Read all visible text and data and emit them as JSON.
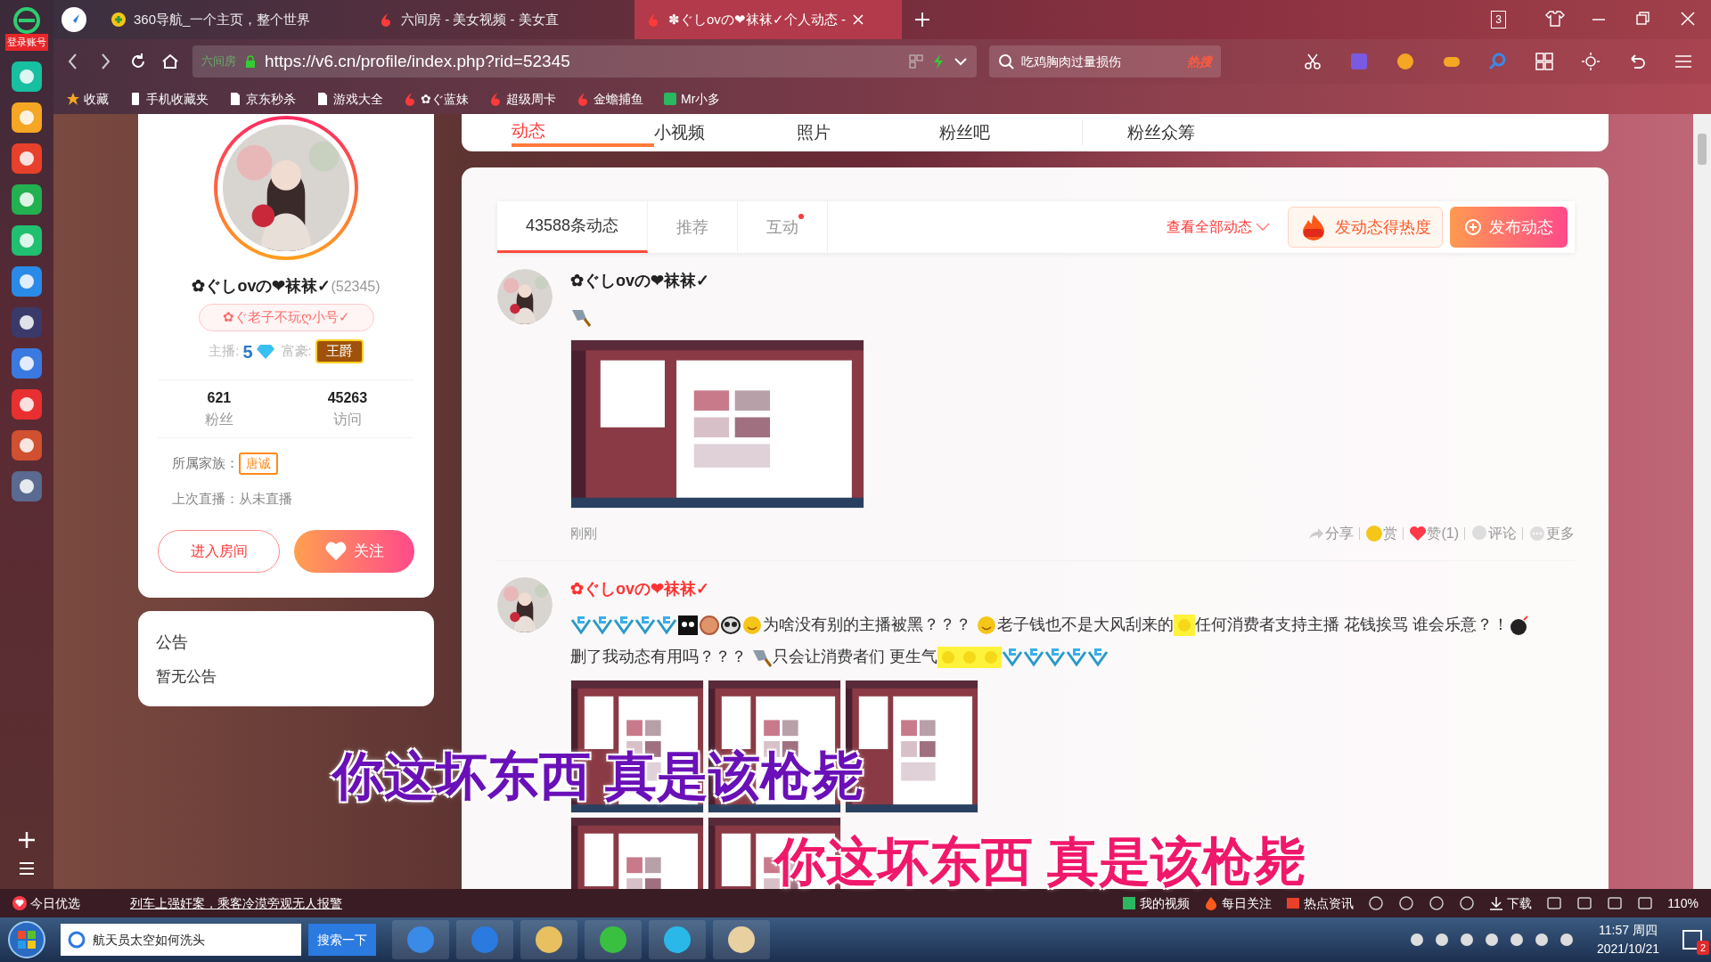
{
  "browser": {
    "tabs": [
      {
        "title": "360导航_一个主页，整个世界",
        "selected": false,
        "kind": "nav360"
      },
      {
        "title": "六间房 - 美女视频 - 美女直",
        "selected": false,
        "kind": "six"
      },
      {
        "title": "✽ぐしovの❤袜袜✓个人动态 -",
        "selected": true,
        "kind": "six"
      }
    ],
    "tab_count": "3",
    "url_label": "六间房",
    "url": "https://v6.cn/profile/index.php?rid=52345",
    "search_text": "吃鸡胸肉过量损伤",
    "search_badge": "热搜",
    "login_label": "登录账号",
    "bookmarks": [
      {
        "label": "收藏",
        "kind": "star"
      },
      {
        "label": "手机收藏夹",
        "kind": "phone"
      },
      {
        "label": "京东秒杀",
        "kind": "page"
      },
      {
        "label": "游戏大全",
        "kind": "page"
      },
      {
        "label": "✿ぐ蓝妹",
        "kind": "six"
      },
      {
        "label": "超级周卡",
        "kind": "six"
      },
      {
        "label": "金蟾捕鱼",
        "kind": "six"
      },
      {
        "label": "Mr小多",
        "kind": "game"
      }
    ]
  },
  "nav_tabs": [
    {
      "label": "动态",
      "selected": true
    },
    {
      "label": "小视频",
      "selected": false
    },
    {
      "label": "照片",
      "selected": false
    },
    {
      "label": "粉丝吧",
      "selected": false
    },
    {
      "label": "粉丝众筹",
      "selected": false
    }
  ],
  "profile": {
    "name": "✿ぐしovの❤袜袜✓",
    "id": "(52345)",
    "signature": "✿ぐ老子不玩ღ小号✓",
    "anchor_label": "主播:",
    "anchor_level": "5",
    "rich_label": "富豪:",
    "rich_badge": "王爵",
    "stats": [
      {
        "value": "621",
        "label": "粉丝"
      },
      {
        "value": "45263",
        "label": "访问"
      }
    ],
    "family_label": "所属家族：",
    "family": "唐诚",
    "last_live": "上次直播：从未直播",
    "enter_button": "进入房间",
    "follow_button": "关注"
  },
  "notice": {
    "title": "公告",
    "text": "暂无公告"
  },
  "feed": {
    "tabs": [
      {
        "label": "43588条动态",
        "selected": true,
        "dot": false
      },
      {
        "label": "推荐",
        "selected": false,
        "dot": false
      },
      {
        "label": "互动",
        "selected": false,
        "dot": true
      }
    ],
    "filter": "查看全部动态",
    "hot_button": "发动态得热度",
    "publish_button": "发布动态",
    "posts": [
      {
        "author": "✿ぐしovの❤袜袜✓",
        "color": "#222222",
        "content": [
          {
            "kind": "knife"
          }
        ],
        "images": [
          {
            "kind": "picture"
          }
        ],
        "time": "刚刚",
        "actions": [
          {
            "label": "分享",
            "kind": "share"
          },
          {
            "label": "赏",
            "kind": "reward"
          },
          {
            "label": "赞(1)",
            "kind": "like"
          },
          {
            "label": "评论",
            "kind": "comment"
          },
          {
            "label": "更多",
            "kind": "more"
          }
        ]
      },
      {
        "author": "✿ぐしovの❤袜袜✓",
        "color": "#ff3333",
        "content": [
          {
            "kind": "five"
          },
          {
            "kind": "five"
          },
          {
            "kind": "five"
          },
          {
            "kind": "five"
          },
          {
            "kind": "five"
          },
          {
            "kind": "skull"
          },
          {
            "kind": "coin"
          },
          {
            "kind": "alien"
          },
          {
            "kind": "smile"
          },
          {
            "kind": "text",
            "text": "为啥没有别的主播被黑？？？ "
          },
          {
            "kind": "smile"
          },
          {
            "kind": "text",
            "text": "老子钱也不是大风刮来的"
          },
          {
            "kind": "glow"
          },
          {
            "kind": "text",
            "text": "任何消费者支持主播 花钱挨骂 谁会乐意？！"
          },
          {
            "kind": "bomb"
          },
          {
            "kind": "text",
            "text": "删了我动态有用吗？？？ "
          },
          {
            "kind": "knife"
          },
          {
            "kind": "text",
            "text": "只会让消费者们 更生气"
          },
          {
            "kind": "glow"
          },
          {
            "kind": "glow"
          },
          {
            "kind": "glow"
          },
          {
            "kind": "five"
          },
          {
            "kind": "five"
          },
          {
            "kind": "five"
          },
          {
            "kind": "five"
          },
          {
            "kind": "five"
          }
        ],
        "images": [
          {
            "kind": "picture"
          },
          {
            "kind": "picture"
          },
          {
            "kind": "picture"
          },
          {
            "kind": "picture"
          },
          {
            "kind": "picture"
          }
        ]
      }
    ]
  },
  "subtitles": [
    {
      "text": "你这坏东西 真是该枪毙"
    },
    {
      "text": "你这坏东西 真是该枪毙"
    }
  ],
  "status_bar": {
    "today": "今日优选",
    "news": "列车上强奸案，乘客冷漠旁观无人报警",
    "items": [
      {
        "label": "我的视频",
        "kind": "video"
      },
      {
        "label": "每日关注",
        "kind": "fire"
      },
      {
        "label": "热点资讯",
        "kind": "news"
      }
    ],
    "download": "下载",
    "zoom": "110%"
  },
  "taskbar": {
    "search": "航天员太空如何洗头",
    "search_button": "搜索一下",
    "time": "11:57 周四",
    "date": "2021/10/21",
    "notifications": "2"
  }
}
